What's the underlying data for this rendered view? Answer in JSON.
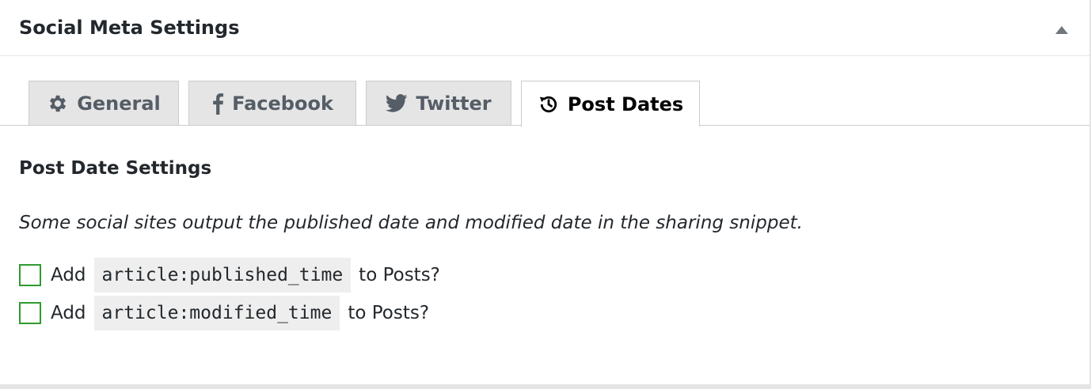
{
  "panel": {
    "title": "Social Meta Settings",
    "toggle_icon": "triangle-up-icon"
  },
  "tabs": [
    {
      "label": "General",
      "icon": "gear-icon",
      "active": false
    },
    {
      "label": "Facebook",
      "icon": "facebook-icon",
      "active": false
    },
    {
      "label": "Twitter",
      "icon": "twitter-icon",
      "active": false
    },
    {
      "label": "Post Dates",
      "icon": "history-icon",
      "active": true
    }
  ],
  "content": {
    "section_title": "Post Date Settings",
    "description": "Some social sites output the published date and modified date in the sharing snippet.",
    "options": [
      {
        "prefix": "Add",
        "code": "article:published_time",
        "suffix": "to Posts?",
        "checked": false
      },
      {
        "prefix": "Add",
        "code": "article:modified_time",
        "suffix": "to Posts?",
        "checked": false
      }
    ]
  },
  "colors": {
    "checkbox_border": "#2e9b2e",
    "tab_inactive_bg": "#e5e5e5",
    "tab_active_bg": "#ffffff",
    "code_bg": "#eeeeee",
    "text": "#23282d"
  }
}
